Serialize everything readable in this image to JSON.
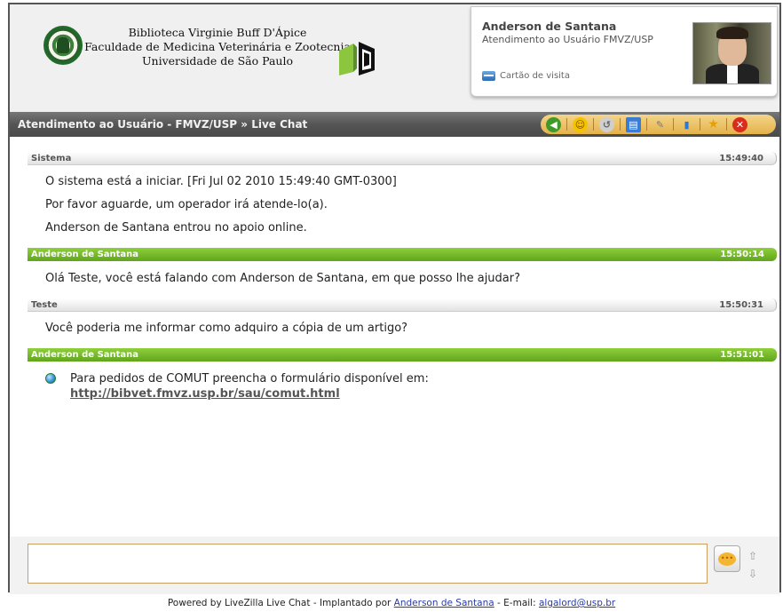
{
  "header": {
    "library_lines": [
      "Biblioteca Virginie Buff D'Ápice",
      "Faculdade de Medicina Veterinária e Zootecnia",
      "Universidade de São Paulo"
    ],
    "agent": {
      "name": "Anderson de Santana",
      "role": "Atendimento ao Usuário FMVZ/USP",
      "vcard_label": "Cartão de visita"
    }
  },
  "titlebar": {
    "title": "Atendimento ao Usuário - FMVZ/USP » Live Chat",
    "tools": [
      "back-icon",
      "smiley-icon",
      "history-icon",
      "print-icon",
      "attach-icon",
      "chart-icon",
      "star-icon",
      "close-icon"
    ]
  },
  "chat": {
    "messages": [
      {
        "sender": "Sistema",
        "time": "15:49:40",
        "kind": "system",
        "lines": [
          "O sistema está a iniciar. [Fri Jul 02 2010 15:49:40 GMT-0300]",
          "Por favor aguarde, um operador irá atende-lo(a).",
          "Anderson de Santana entrou no apoio online."
        ]
      },
      {
        "sender": "Anderson de Santana",
        "time": "15:50:14",
        "kind": "operator",
        "lines": [
          "Olá Teste, você está falando com Anderson de Santana, em que posso lhe ajudar?"
        ]
      },
      {
        "sender": "Teste",
        "time": "15:50:31",
        "kind": "system",
        "lines": [
          "Você poderia me informar como adquiro a cópia de um artigo?"
        ]
      },
      {
        "sender": "Anderson de Santana",
        "time": "15:51:01",
        "kind": "operator",
        "text": "Para pedidos de COMUT preencha o formulário disponível em:",
        "link": "http://bibvet.fmvz.usp.br/sau/comut.html"
      }
    ]
  },
  "input": {
    "value": "",
    "placeholder": ""
  },
  "footer": {
    "prefix": "Powered by LiveZilla Live Chat - Implantado por",
    "author_link": "Anderson de Santana",
    "email_prefix": "- E-mail:",
    "email": "algalord@usp.br"
  },
  "colors": {
    "operator_header": "#6fb626",
    "toolbar": "#e9bf5c",
    "titlebar": "#555555"
  }
}
